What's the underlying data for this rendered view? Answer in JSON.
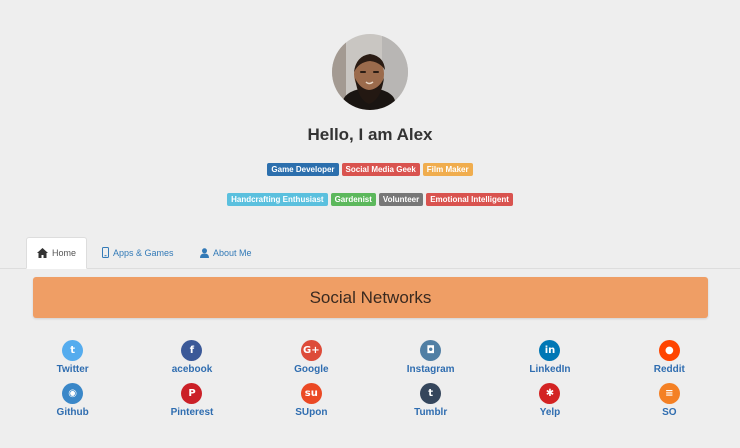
{
  "profile": {
    "greeting": "Hello, I am Alex"
  },
  "badges": {
    "row1": [
      {
        "label": "Game Developer",
        "color": "#2c6fad"
      },
      {
        "label": "Social Media Geek",
        "color": "#d9534f"
      },
      {
        "label": "Film Maker",
        "color": "#f0ad4e"
      }
    ],
    "row2": [
      {
        "label": "Handcrafting Enthusiast",
        "color": "#5bc0de"
      },
      {
        "label": "Gardenist",
        "color": "#5cb85c"
      },
      {
        "label": "Volunteer",
        "color": "#777777"
      },
      {
        "label": "Emotional Intelligent",
        "color": "#d9534f"
      }
    ]
  },
  "tabs": {
    "home": "Home",
    "apps": "Apps & Games",
    "about": "About Me"
  },
  "social": {
    "title": "Social Networks",
    "items": [
      {
        "label": "Twitter",
        "icon": "twitter-icon",
        "glyph": "t",
        "color": "#55acee"
      },
      {
        "label": "acebook",
        "icon": "facebook-icon",
        "glyph": "f",
        "color": "#3b5998"
      },
      {
        "label": "Google",
        "icon": "google-plus-icon",
        "glyph": "G+",
        "color": "#dd4b39"
      },
      {
        "label": "Instagram",
        "icon": "instagram-icon",
        "glyph": "◘",
        "color": "#517fa4"
      },
      {
        "label": "LinkedIn",
        "icon": "linkedin-icon",
        "glyph": "in",
        "color": "#0077b5"
      },
      {
        "label": "Reddit",
        "icon": "reddit-icon",
        "glyph": "●",
        "color": "#ff4500"
      },
      {
        "label": "Github",
        "icon": "github-icon",
        "glyph": "◉",
        "color": "#3a87c8"
      },
      {
        "label": "Pinterest",
        "icon": "pinterest-icon",
        "glyph": "P",
        "color": "#cb2027"
      },
      {
        "label": "SUpon",
        "icon": "stumbleupon-icon",
        "glyph": "su",
        "color": "#eb4924"
      },
      {
        "label": "Tumblr",
        "icon": "tumblr-icon",
        "glyph": "t",
        "color": "#35465c"
      },
      {
        "label": "Yelp",
        "icon": "yelp-icon",
        "glyph": "✱",
        "color": "#d32323"
      },
      {
        "label": "SO",
        "icon": "stackoverflow-icon",
        "glyph": "≡",
        "color": "#f48024"
      }
    ]
  }
}
